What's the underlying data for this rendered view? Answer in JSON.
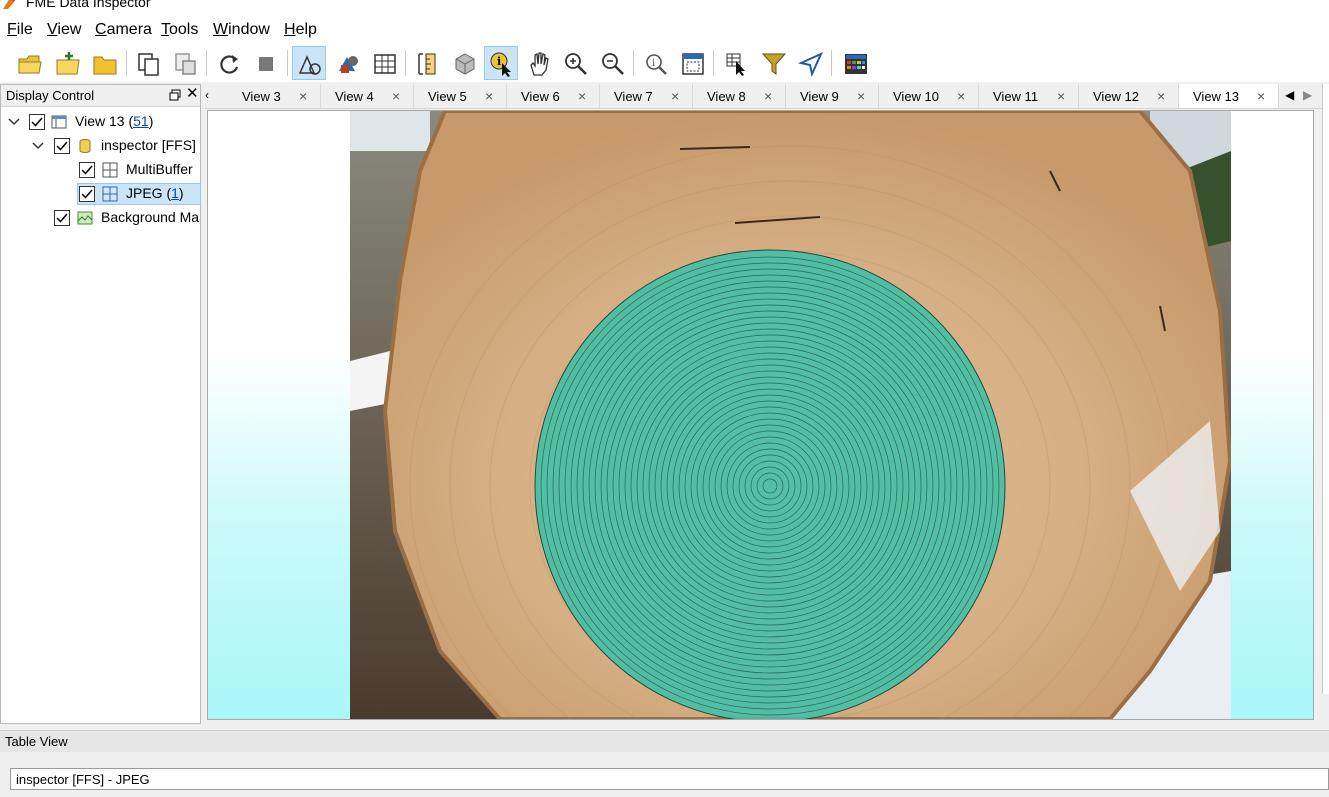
{
  "window": {
    "title": "FME Data Inspector"
  },
  "menu": {
    "items": [
      {
        "first": "F",
        "rest": "ile"
      },
      {
        "first": "V",
        "rest": "iew"
      },
      {
        "first": "C",
        "rest": "amera"
      },
      {
        "first": "T",
        "rest": "ools"
      },
      {
        "first": "W",
        "rest": "indow"
      },
      {
        "first": "H",
        "rest": "elp"
      }
    ]
  },
  "toolbar": {
    "buttons": [
      "open-dataset",
      "add-dataset",
      "open-folder",
      "copy",
      "paste-special",
      "refresh",
      "stop",
      "feature-types",
      "3d-view",
      "table-view",
      "measure",
      "cube-3d",
      "select-info",
      "pan",
      "zoom-in",
      "zoom-out",
      "inspect",
      "zoom-extents",
      "select-features",
      "filter",
      "navigate",
      "color-palette"
    ],
    "active": [
      "feature-types",
      "select-info"
    ]
  },
  "display_control": {
    "title": "Display Control",
    "tree": [
      {
        "name": "View 13 (",
        "count": "51",
        "suffix": ")"
      },
      {
        "name": "inspector [FFS]"
      },
      {
        "name": "MultiBuffer"
      },
      {
        "name": "JPEG (",
        "count": "1",
        "suffix": ")"
      },
      {
        "name": "Background Map"
      }
    ]
  },
  "tabs": {
    "items": [
      {
        "label": "View 3"
      },
      {
        "label": "View 4"
      },
      {
        "label": "View 5"
      },
      {
        "label": "View 6"
      },
      {
        "label": "View 7"
      },
      {
        "label": "View 8"
      },
      {
        "label": "View 9"
      },
      {
        "label": "View 10"
      },
      {
        "label": "View 11"
      },
      {
        "label": "View 12"
      },
      {
        "label": "View 13"
      }
    ],
    "active": "View 13",
    "close_glyph": "×"
  },
  "map": {
    "overlay_color": "#3fbfa6",
    "background_gradient": [
      "#ffffff",
      "#a9f7f8"
    ]
  },
  "table_view": {
    "title": "Table View",
    "selected_table": "inspector [FFS] - JPEG"
  }
}
